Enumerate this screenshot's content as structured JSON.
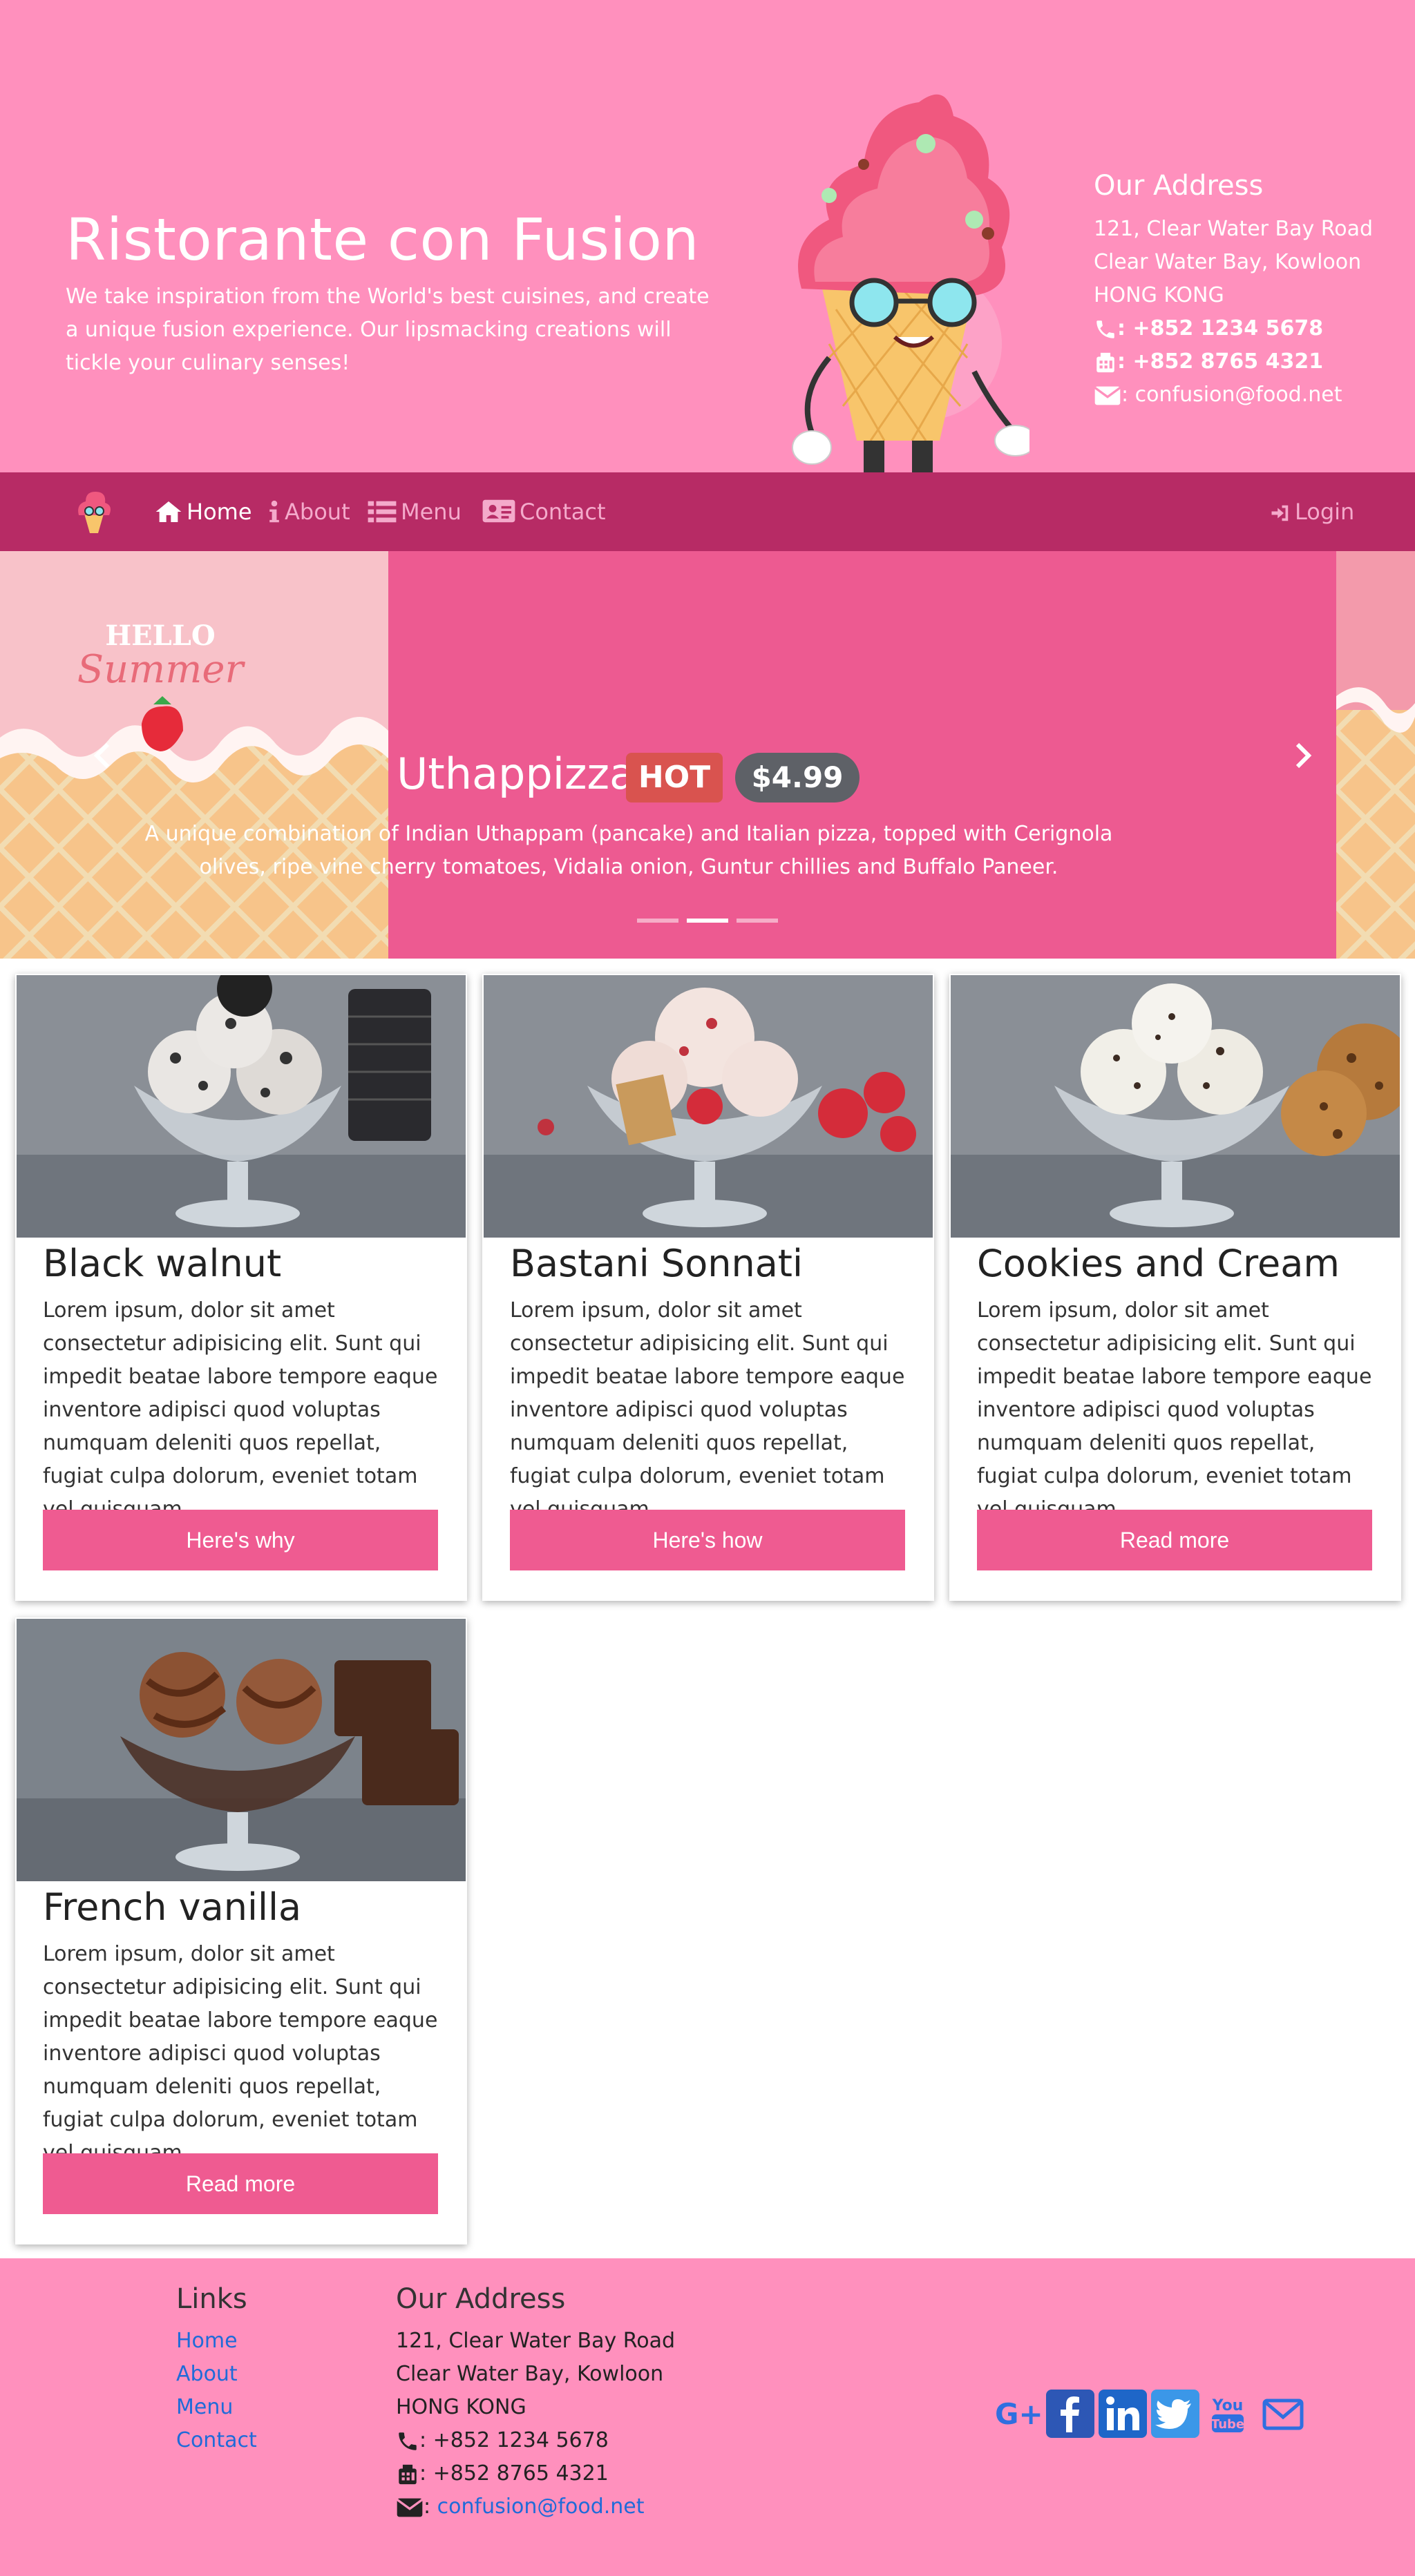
{
  "header": {
    "title": "Ristorante con Fusion",
    "description": "We take inspiration from the World's best cuisines, and create a unique fusion experience. Our lipsmacking creations will tickle your culinary senses!",
    "address": {
      "heading": "Our Address",
      "line1": "121, Clear Water Bay Road",
      "line2": "Clear Water Bay, Kowloon",
      "line3": "HONG KONG",
      "phone": ": +852 1234 5678",
      "fax": ": +852 8765 4321",
      "email": ": confusion@food.net"
    }
  },
  "nav": {
    "home": "Home",
    "about": "About",
    "menu": "Menu",
    "contact": "Contact",
    "login": "Login"
  },
  "carousel": {
    "title": "Uthappizza",
    "badge": "HOT",
    "price": "$4.99",
    "description": "A unique combination of Indian Uthappam (pancake) and Italian pizza, topped with Cerignola olives, ripe vine cherry tomatoes, Vidalia onion, Guntur chillies and Buffalo Paneer.",
    "slide_text": "HELLO Summer",
    "active_index": 1,
    "count": 3
  },
  "cards": [
    {
      "title": "Black walnut",
      "text": "Lorem ipsum, dolor sit amet consectetur adipisicing elit. Sunt qui impedit beatae labore tempore eaque inventore adipisci quod voluptas numquam deleniti quos repellat, fugiat culpa dolorum, eveniet totam vel quisquam.",
      "button": "Here's why"
    },
    {
      "title": "Bastani Sonnati",
      "text": "Lorem ipsum, dolor sit amet consectetur adipisicing elit. Sunt qui impedit beatae labore tempore eaque inventore adipisci quod voluptas numquam deleniti quos repellat, fugiat culpa dolorum, eveniet totam vel quisquam.",
      "button": "Here's how"
    },
    {
      "title": "Cookies and Cream",
      "text": "Lorem ipsum, dolor sit amet consectetur adipisicing elit. Sunt qui impedit beatae labore tempore eaque inventore adipisci quod voluptas numquam deleniti quos repellat, fugiat culpa dolorum, eveniet totam vel quisquam.",
      "button": "Read more"
    },
    {
      "title": "French vanilla",
      "text": "Lorem ipsum, dolor sit amet consectetur adipisicing elit. Sunt qui impedit beatae labore tempore eaque inventore adipisci quod voluptas numquam deleniti quos repellat, fugiat culpa dolorum, eveniet totam vel quisquam.",
      "button": "Read more"
    }
  ],
  "footer": {
    "links_heading": "Links",
    "links": [
      "Home",
      "About",
      "Menu",
      "Contact"
    ],
    "address_heading": "Our Address",
    "line1": "121, Clear Water Bay Road",
    "line2": "Clear Water Bay, Kowloon",
    "line3": "HONG KONG",
    "phone": ": +852 1234 5678",
    "fax": ": +852 8765 4321",
    "email": "confusion@food.net",
    "social_icons": [
      "google-plus-icon",
      "facebook-icon",
      "linkedin-icon",
      "twitter-icon",
      "youtube-icon",
      "mail-icon"
    ]
  },
  "colors": {
    "header_bg": "#ff90bd",
    "navbar_bg": "#b72b65",
    "carousel_bg": "#ed5a91",
    "button_bg": "#ef5b91",
    "badge_hot": "#d9534f",
    "badge_price": "#5e6167",
    "link": "#1f6bd9"
  }
}
